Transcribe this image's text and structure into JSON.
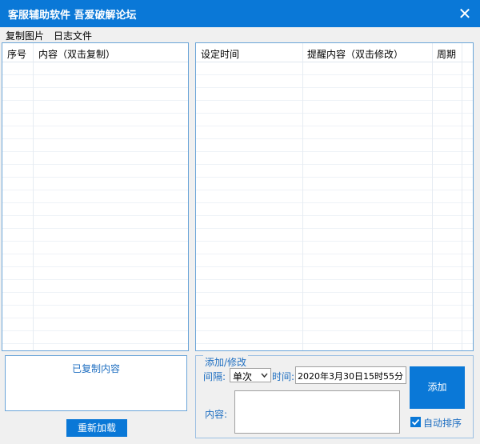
{
  "window": {
    "title": "客服辅助软件 吾爱破解论坛",
    "close_glyph": "✕"
  },
  "menu": {
    "items": [
      "复制图片",
      "日志文件"
    ]
  },
  "left_table": {
    "columns": [
      "序号",
      "内容（双击复制）"
    ],
    "rows": []
  },
  "right_table": {
    "columns": [
      "设定时间",
      "提醒内容（双击修改）",
      "周期"
    ],
    "rows": []
  },
  "copied": {
    "label": "已复制内容",
    "reload_button": "重新加载"
  },
  "edit_group": {
    "legend": "添加/修改",
    "interval_label": "间隔:",
    "interval_value": "单次",
    "time_label": "时间:",
    "time_value": "2020年3月30日15时55分",
    "content_label": "内容:",
    "add_button": "添加",
    "auto_sort_label": "自动排序",
    "auto_sort_checked": true
  },
  "colors": {
    "accent": "#0a78d7",
    "label_blue": "#1f6fc1",
    "panel_border": "#6aa4d8"
  },
  "icons": {
    "close": "close-icon",
    "dropdown": "chevron-down-icon",
    "check": "check-icon"
  }
}
